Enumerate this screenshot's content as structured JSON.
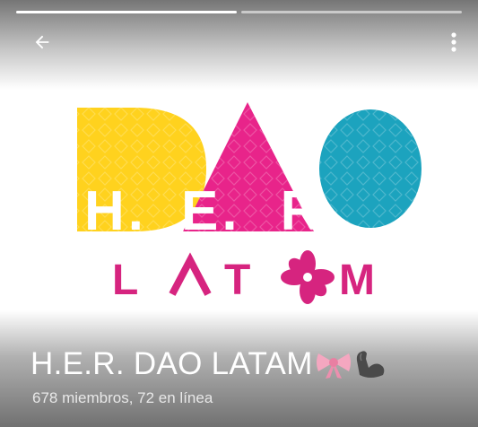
{
  "header": {
    "back_icon": "arrow-left-icon",
    "menu_icon": "more-vertical-icon"
  },
  "progress": [
    {
      "fill_fraction": 1.0
    },
    {
      "fill_fraction": 0.0
    }
  ],
  "logo": {
    "line1_letters": [
      "D",
      "A",
      "O"
    ],
    "line2_letters": [
      "H",
      ".",
      "E",
      ".",
      "R",
      "."
    ],
    "line3_letters": [
      "L",
      "A",
      "T",
      "M"
    ],
    "flower_icon": "hibiscus-flower-icon",
    "colors": {
      "yellow": "#FFD21E",
      "pink": "#E8248A",
      "teal": "#1CA3BE",
      "magenta_text": "#D6247F"
    }
  },
  "group": {
    "title": "H.E.R. DAO LATAM",
    "emojis": [
      "ribbon-bow-icon",
      "flexed-biceps-icon"
    ],
    "subtitle": "678 miembros, 72 en línea"
  },
  "colors": {
    "topbar_gradient": "#6E6E6E",
    "bottom_gradient": "#696969",
    "text_on_gradient": "#FFFFFF"
  }
}
